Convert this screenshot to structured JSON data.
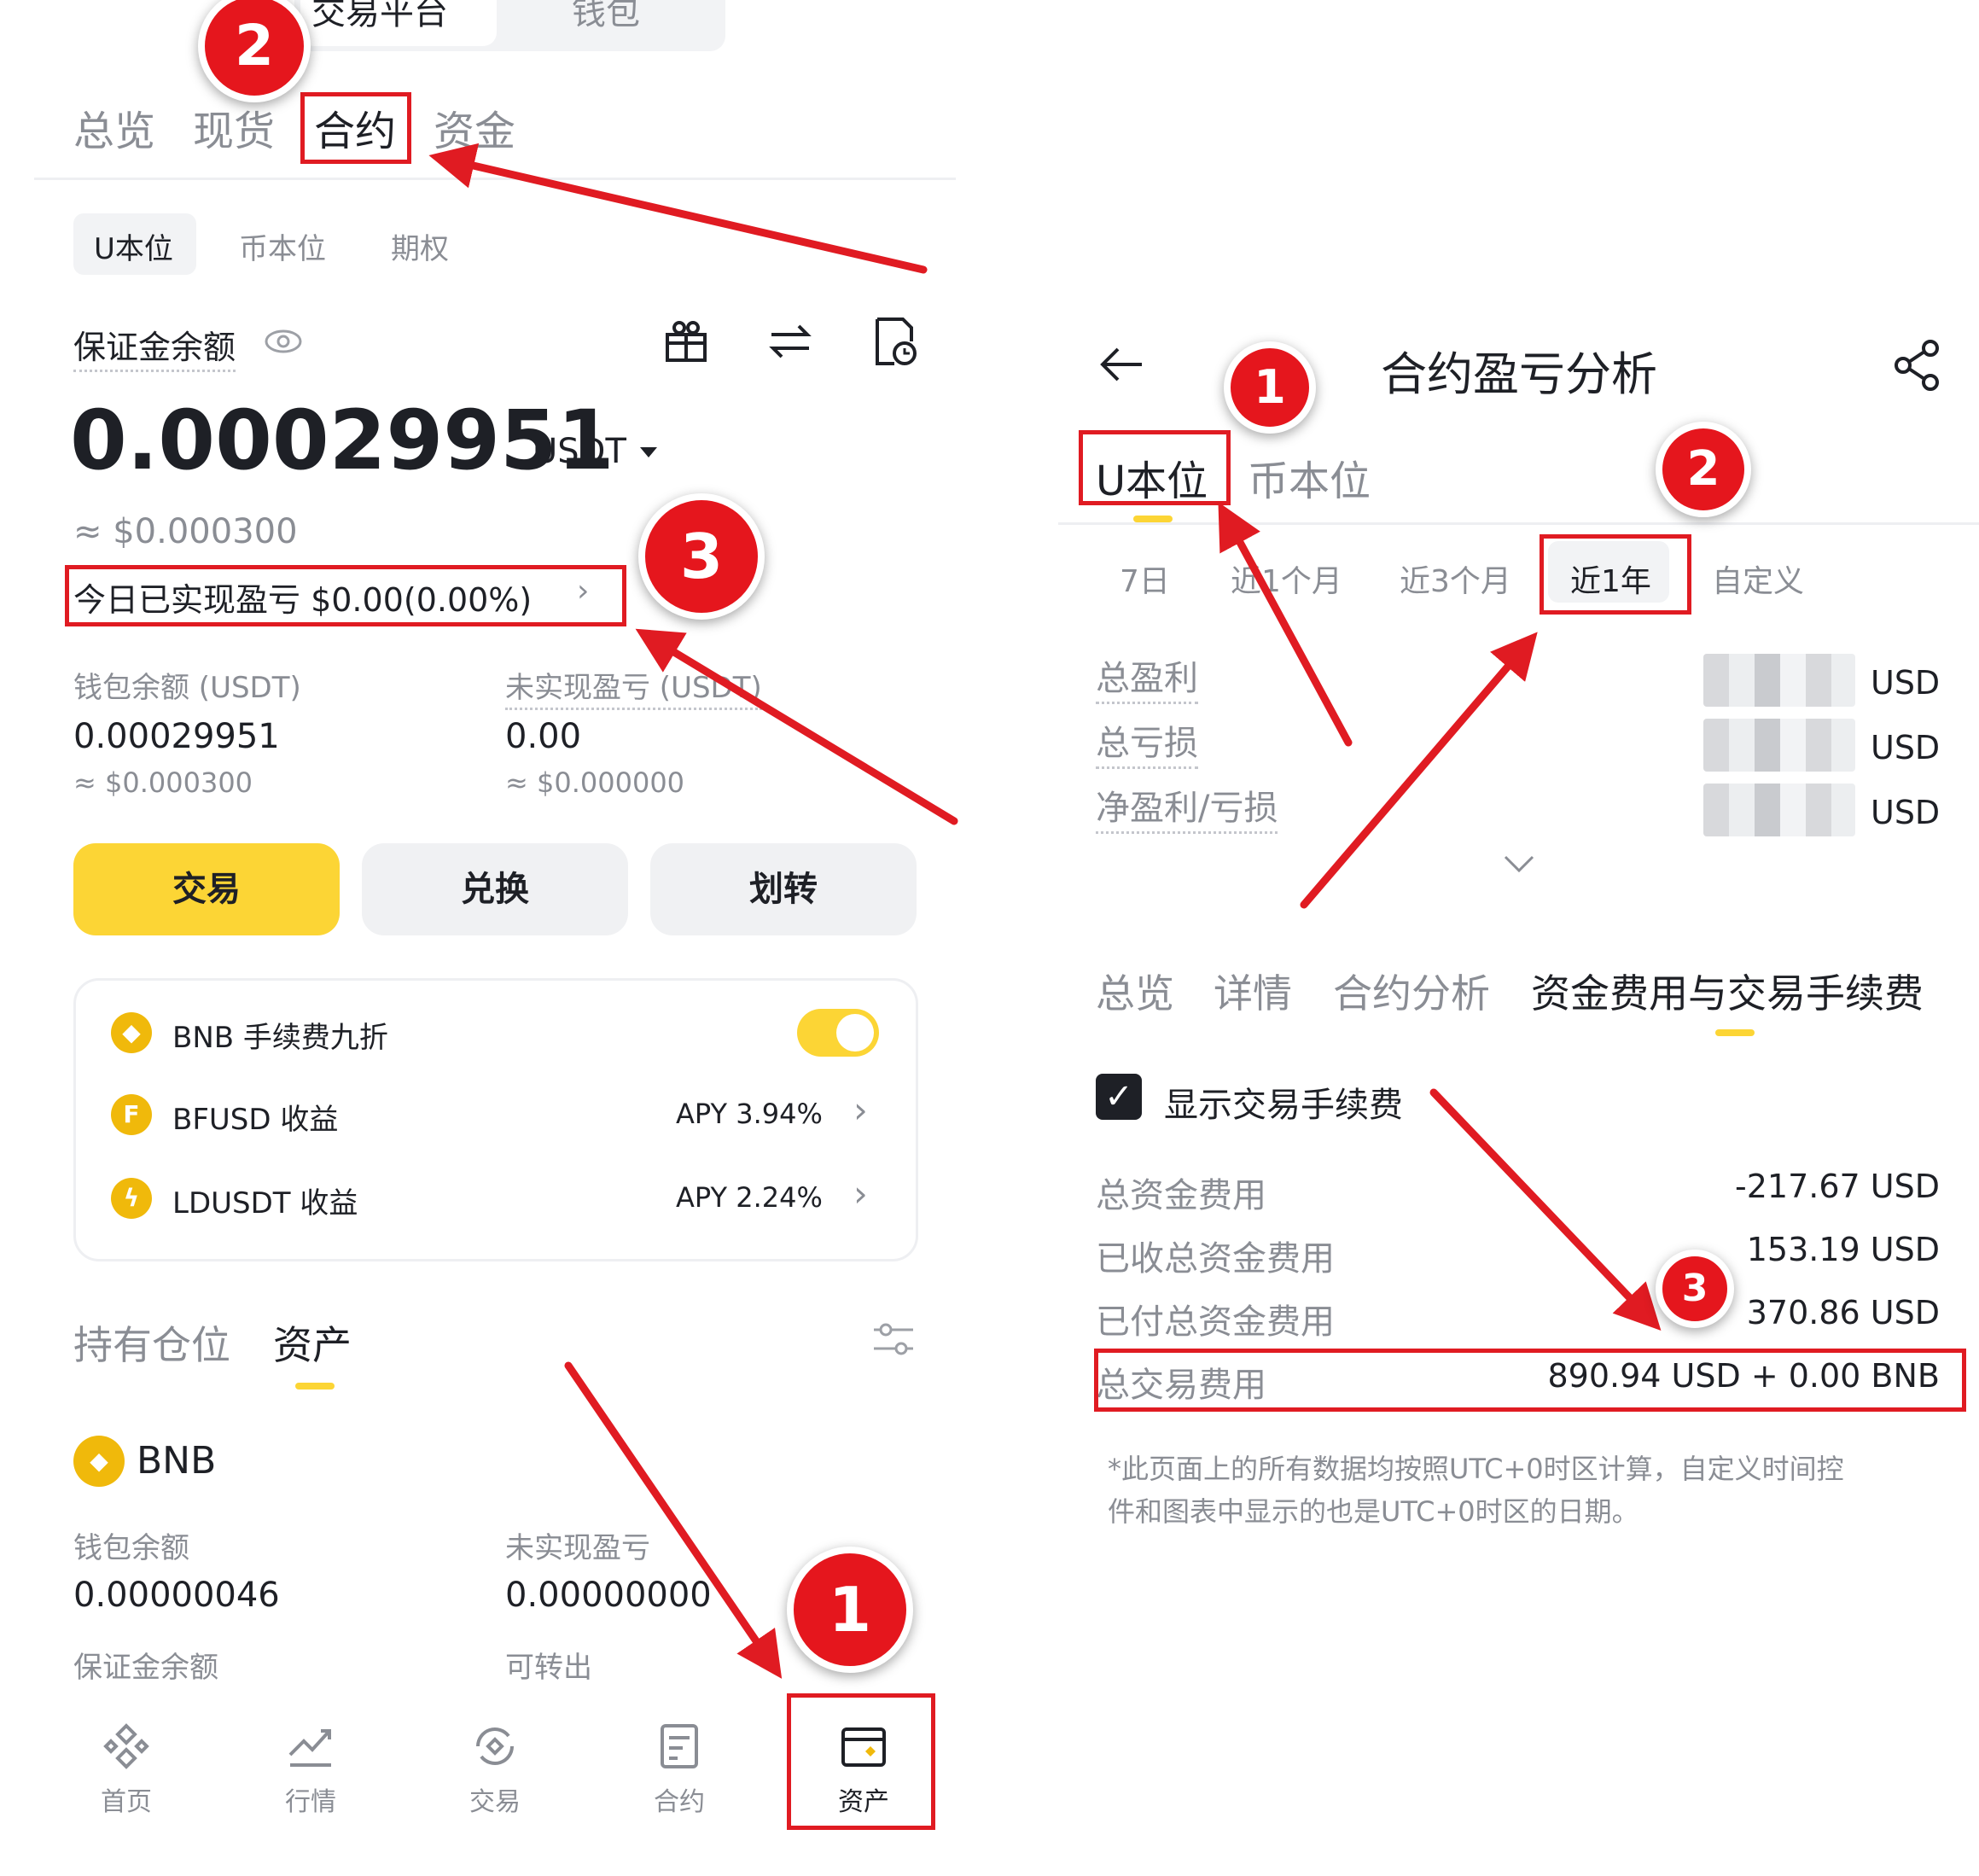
{
  "left": {
    "top_tabs": [
      "交易平台",
      "钱包"
    ],
    "main_tabs": [
      "总览",
      "现货",
      "合约",
      "资金"
    ],
    "sub_tabs": [
      "U本位",
      "币本位",
      "期权"
    ],
    "margin_label": "保证金余额",
    "balance_value": "0.00029951",
    "balance_unit": "USDT",
    "balance_usd": "≈ $0.000300",
    "today_pnl": "今日已实现盈亏 $0.00(0.00%)",
    "wallet_label": "钱包余额 (USDT)",
    "wallet_value": "0.00029951",
    "wallet_usd": "≈ $0.000300",
    "unrealized_label": "未实现盈亏 (USDT)",
    "unrealized_value": "0.00",
    "unrealized_usd": "≈ $0.000000",
    "buttons": [
      "交易",
      "兑换",
      "划转"
    ],
    "card": {
      "bnb_fee": "BNB 手续费九折",
      "bfusd": "BFUSD 收益",
      "bfusd_apy": "APY 3.94%",
      "ldusdt": "LDUSDT 收益",
      "ldusdt_apy": "APY 2.24%"
    },
    "position_tabs": [
      "持有仓位",
      "资产"
    ],
    "asset_name": "BNB",
    "asset_wallet_label": "钱包余额",
    "asset_wallet_value": "0.00000046",
    "asset_unrealized_label": "未实现盈亏",
    "asset_unrealized_value": "0.00000000",
    "asset_margin_label": "保证金余额",
    "asset_transfer_label": "可转出",
    "nav": [
      "首页",
      "行情",
      "交易",
      "合约",
      "资产"
    ]
  },
  "right": {
    "title": "合约盈亏分析",
    "tabs": [
      "U本位",
      "币本位"
    ],
    "periods": [
      "7日",
      "近1个月",
      "近3个月",
      "近1年",
      "自定义"
    ],
    "profit_labels": [
      "总盈利",
      "总亏损",
      "净盈利/亏损"
    ],
    "profit_unit": "USD",
    "section_tabs": [
      "总览",
      "详情",
      "合约分析",
      "资金费用与交易手续费"
    ],
    "show_fee_label": "显示交易手续费",
    "fee_rows": [
      {
        "label": "总资金费用",
        "value": "-217.67 USD"
      },
      {
        "label": "已收总资金费用",
        "value": "153.19 USD"
      },
      {
        "label": "已付总资金费用",
        "value": "370.86 USD"
      },
      {
        "label": "总交易费用",
        "value": "890.94 USD + 0.00 BNB"
      }
    ],
    "footnote_line1": "*此页面上的所有数据均按照UTC+0时区计算，自定义时间控",
    "footnote_line2": "件和图表中显示的也是UTC+0时区的日期。"
  },
  "annotations": {
    "left_badges": [
      "1",
      "2",
      "3"
    ],
    "right_badges": [
      "1",
      "2",
      "3"
    ]
  },
  "colors": {
    "accent": "#fcd535",
    "annotation_red": "#e01b22",
    "text": "#1e2026",
    "muted": "#8a8d94"
  }
}
